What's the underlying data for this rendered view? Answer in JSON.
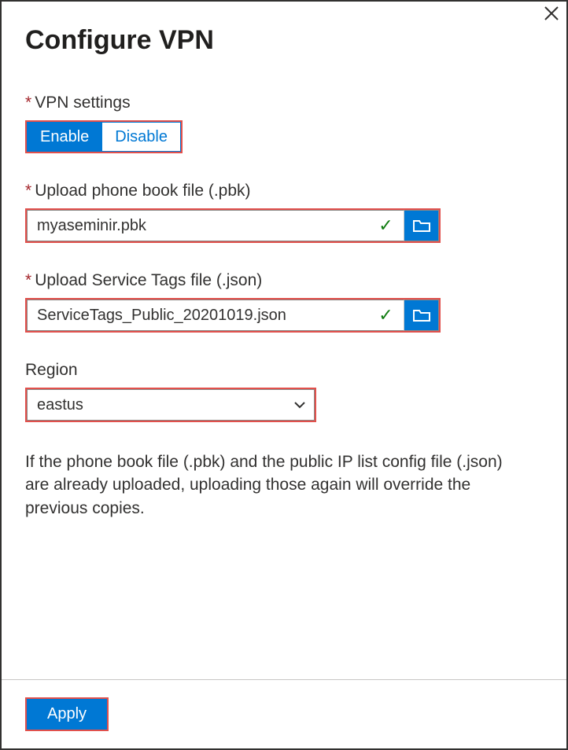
{
  "title": "Configure VPN",
  "fields": {
    "vpn": {
      "label": "VPN settings",
      "required": true,
      "options": {
        "enable": "Enable",
        "disable": "Disable"
      },
      "selected": "enable"
    },
    "pbk": {
      "label": "Upload phone book file (.pbk)",
      "required": true,
      "value": "myaseminir.pbk",
      "valid": true
    },
    "stags": {
      "label": "Upload Service Tags file (.json)",
      "required": true,
      "value": "ServiceTags_Public_20201019.json",
      "valid": true
    },
    "region": {
      "label": "Region",
      "required": false,
      "value": "eastus"
    }
  },
  "help": "If the phone book file (.pbk) and the public IP list config file (.json) are already uploaded, uploading those again will override the previous copies.",
  "buttons": {
    "apply": "Apply"
  }
}
